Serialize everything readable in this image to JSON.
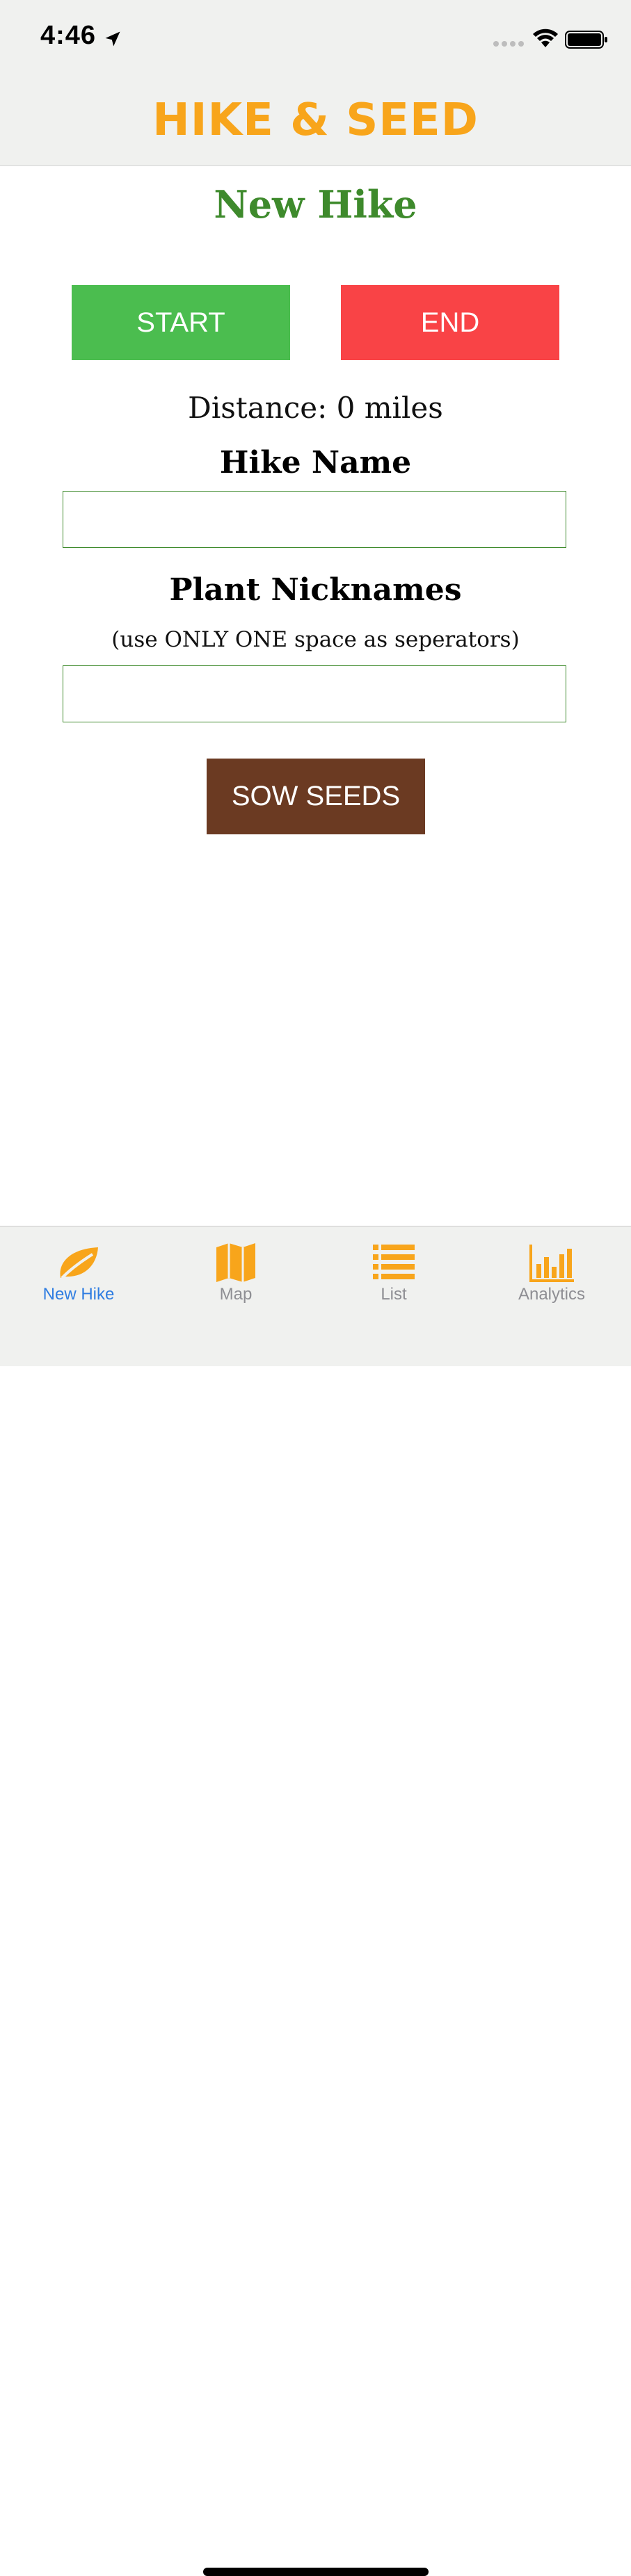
{
  "status_bar": {
    "time": "4:46"
  },
  "header": {
    "title": "HIKE & SEED"
  },
  "main": {
    "page_title": "New Hike",
    "start_label": "START",
    "end_label": "END",
    "distance_text": "Distance: 0 miles",
    "hike_name_label": "Hike Name",
    "hike_name_value": "",
    "plant_label": "Plant Nicknames",
    "plant_hint": "(use ONLY ONE space as seperators)",
    "plant_value": "",
    "sow_label": "SOW SEEDS"
  },
  "tabs": [
    {
      "label": "New Hike",
      "icon": "leaf-icon",
      "active": true
    },
    {
      "label": "Map",
      "icon": "map-icon",
      "active": false
    },
    {
      "label": "List",
      "icon": "list-icon",
      "active": false
    },
    {
      "label": "Analytics",
      "icon": "bar-chart-icon",
      "active": false
    }
  ],
  "colors": {
    "brand_orange": "#f8a51b",
    "title_green": "#3e8a2c",
    "start_green": "#4bbd4f",
    "end_red": "#f94346",
    "sow_brown": "#6b3a22",
    "tab_active_blue": "#2f7de1"
  }
}
